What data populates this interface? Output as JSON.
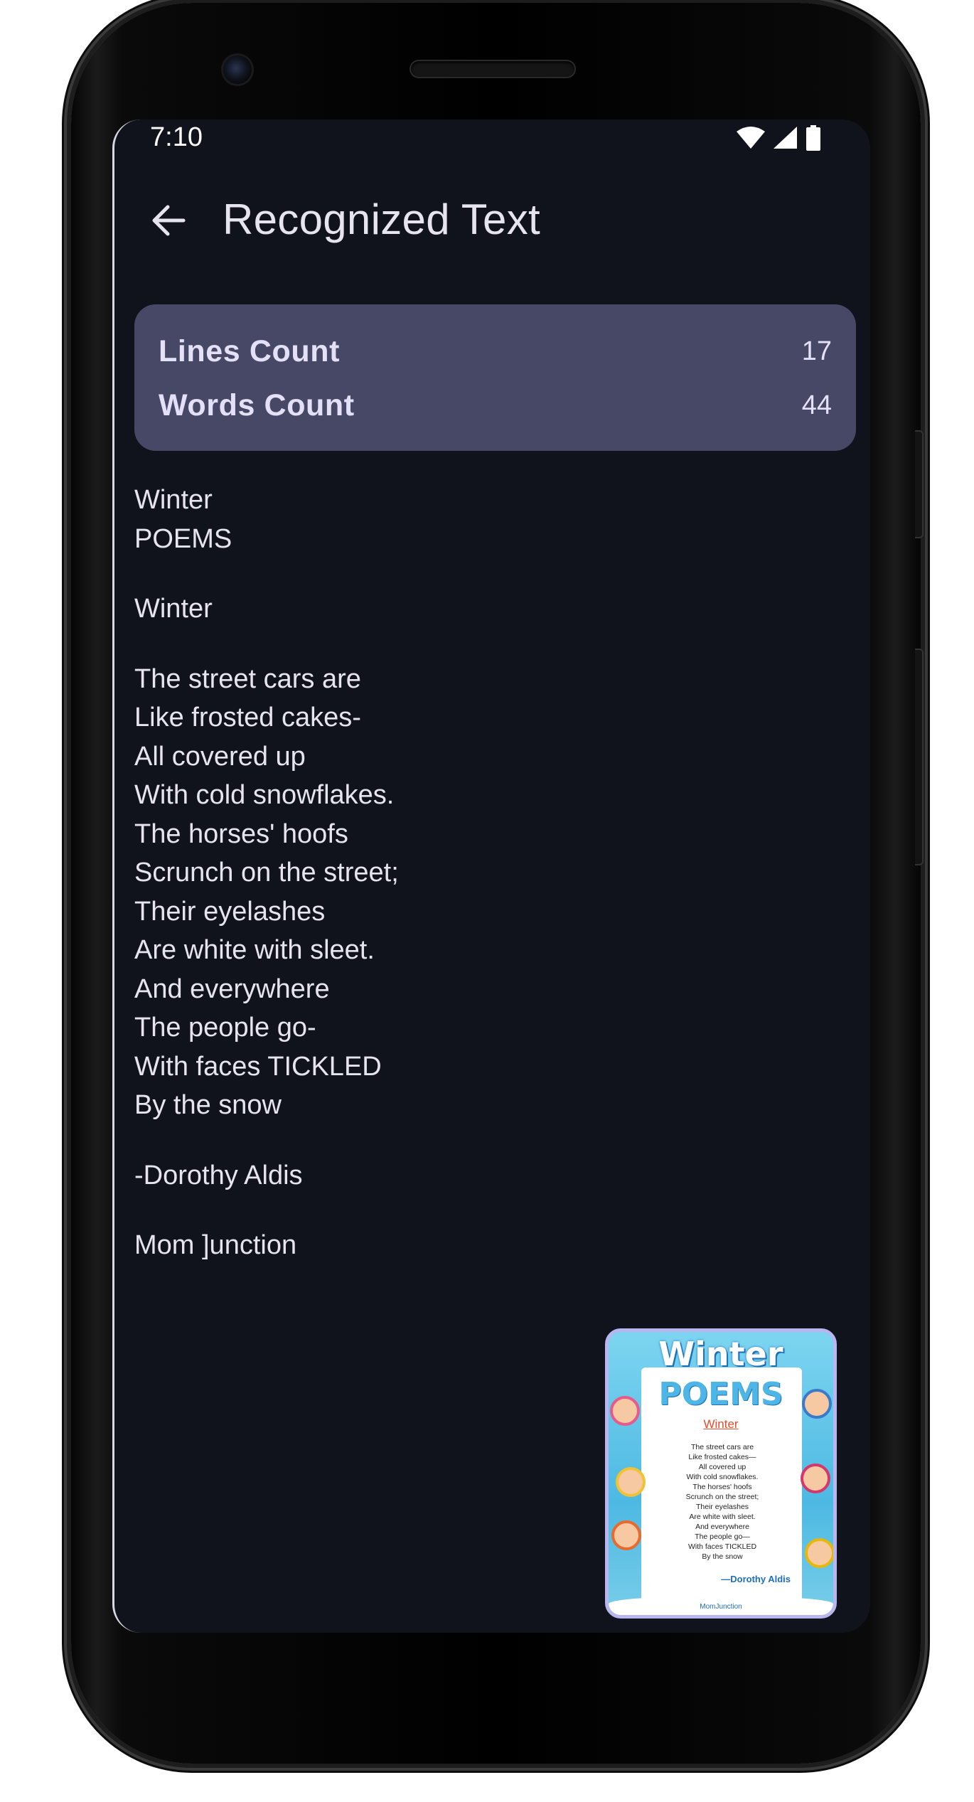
{
  "status_bar": {
    "time": "7:10",
    "icons": [
      "wifi-icon",
      "cellular-signal-icon",
      "battery-icon"
    ]
  },
  "app_bar": {
    "back_icon": "arrow-left-icon",
    "title": "Recognized Text"
  },
  "stats": {
    "lines_label": "Lines Count",
    "lines_value": "17",
    "words_label": "Words Count",
    "words_value": "44"
  },
  "recognized_text": {
    "blocks": [
      [
        "Winter",
        "POEMS"
      ],
      [
        "Winter"
      ],
      [
        "The street cars are",
        "Like frosted cakes-",
        "All covered up",
        "With cold snowflakes.",
        "The horses' hoofs",
        "Scrunch on the street;",
        "Their eyelashes",
        "Are white with sleet.",
        "And everywhere",
        "The people go-",
        "With faces TICKLED",
        "By the snow"
      ],
      [
        "-Dorothy Aldis"
      ],
      [
        "Mom ]unction"
      ]
    ]
  },
  "thumbnail": {
    "title_line1": "Winter",
    "title_line2": "POEMS",
    "subtitle": "Winter",
    "lines": [
      "The street cars are",
      "Like frosted cakes—",
      "All covered up",
      "With cold snowflakes.",
      "The horses' hoofs",
      "Scrunch on the street;",
      "Their eyelashes",
      "Are white with sleet.",
      "And everywhere",
      "The people go—",
      "With faces TICKLED",
      "By the snow"
    ],
    "author": "—Dorothy Aldis",
    "brand": "MomJunction"
  },
  "colors": {
    "screen_bg": "#11131c",
    "card_bg": "#474866",
    "text": "#e6e4ee",
    "thumb_border": "#b9b6ef"
  }
}
